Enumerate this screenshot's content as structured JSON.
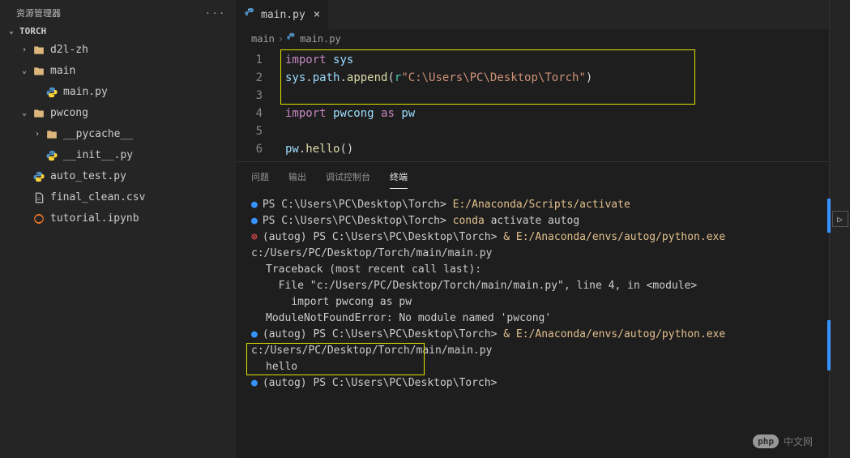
{
  "sidebar": {
    "title": "资源管理器",
    "project": "TORCH",
    "items": [
      {
        "name": "d2l-zh",
        "type": "folder",
        "indent": 1,
        "expanded": false
      },
      {
        "name": "main",
        "type": "folder",
        "indent": 1,
        "expanded": true
      },
      {
        "name": "main.py",
        "type": "py",
        "indent": 2
      },
      {
        "name": "pwcong",
        "type": "folder",
        "indent": 1,
        "expanded": true
      },
      {
        "name": "__pycache__",
        "type": "folder",
        "indent": 2,
        "expanded": false
      },
      {
        "name": "__init__.py",
        "type": "py",
        "indent": 2
      },
      {
        "name": "auto_test.py",
        "type": "py",
        "indent": 1
      },
      {
        "name": "final_clean.csv",
        "type": "csv",
        "indent": 1
      },
      {
        "name": "tutorial.ipynb",
        "type": "ipynb",
        "indent": 1
      }
    ]
  },
  "tab": {
    "filename": "main.py"
  },
  "breadcrumb": {
    "seg1": "main",
    "seg2": "main.py"
  },
  "code": {
    "lines": [
      {
        "n": "1",
        "tokens": [
          [
            "kw",
            "import"
          ],
          [
            "pln",
            " "
          ],
          [
            "var",
            "sys"
          ]
        ]
      },
      {
        "n": "2",
        "tokens": [
          [
            "var",
            "sys"
          ],
          [
            "pln",
            "."
          ],
          [
            "var",
            "path"
          ],
          [
            "pln",
            "."
          ],
          [
            "fn",
            "append"
          ],
          [
            "pln",
            "("
          ],
          [
            "obj",
            "r"
          ],
          [
            "str",
            "\"C:\\Users\\PC\\Desktop\\Torch\""
          ],
          [
            "pln",
            ")"
          ]
        ]
      },
      {
        "n": "3",
        "tokens": []
      },
      {
        "n": "4",
        "tokens": [
          [
            "kw",
            "import"
          ],
          [
            "pln",
            " "
          ],
          [
            "var",
            "pwcong"
          ],
          [
            "pln",
            " "
          ],
          [
            "kw",
            "as"
          ],
          [
            "pln",
            " "
          ],
          [
            "var",
            "pw"
          ]
        ]
      },
      {
        "n": "5",
        "tokens": []
      },
      {
        "n": "6",
        "tokens": [
          [
            "var",
            "pw"
          ],
          [
            "pln",
            "."
          ],
          [
            "fn",
            "hello"
          ],
          [
            "pln",
            "()"
          ]
        ]
      }
    ]
  },
  "panel": {
    "tabs": {
      "problems": "问题",
      "output": "输出",
      "debug": "调试控制台",
      "terminal": "终端"
    }
  },
  "terminal": {
    "lines": [
      {
        "bullet": "blue",
        "parts": [
          [
            "w",
            "PS C:\\Users\\PC\\Desktop\\Torch> "
          ],
          [
            "g",
            "E:/Anaconda/Scripts/activate"
          ]
        ]
      },
      {
        "bullet": "blue",
        "parts": [
          [
            "w",
            "PS C:\\Users\\PC\\Desktop\\Torch> "
          ],
          [
            "g",
            "conda "
          ],
          [
            "w",
            "activate autog"
          ]
        ]
      },
      {
        "bullet": "red",
        "parts": [
          [
            "w",
            "(autog) PS C:\\Users\\PC\\Desktop\\Torch> "
          ],
          [
            "g",
            "& "
          ],
          [
            "g",
            "E:/Anaconda/envs/autog/python.exe "
          ],
          [
            "w",
            "c:/Users/PC/Desktop/Torch/main/main.py"
          ]
        ]
      },
      {
        "bullet": "",
        "parts": [
          [
            "w",
            "Traceback (most recent call last):"
          ]
        ]
      },
      {
        "bullet": "",
        "parts": [
          [
            "w",
            "  File \"c:/Users/PC/Desktop/Torch/main/main.py\", line 4, in <module>"
          ]
        ]
      },
      {
        "bullet": "",
        "parts": [
          [
            "w",
            "    import pwcong as pw"
          ]
        ]
      },
      {
        "bullet": "",
        "parts": [
          [
            "w",
            "ModuleNotFoundError: No module named 'pwcong'"
          ]
        ]
      },
      {
        "bullet": "blue",
        "parts": [
          [
            "w",
            "(autog) PS C:\\Users\\PC\\Desktop\\Torch> "
          ],
          [
            "g",
            "& "
          ],
          [
            "g",
            "E:/Anaconda/envs/autog/python.exe "
          ],
          [
            "w",
            "c:/Users/PC/Desktop/Torch/main/main.py"
          ]
        ]
      },
      {
        "bullet": "",
        "parts": [
          [
            "w",
            "hello"
          ]
        ]
      },
      {
        "bullet": "blue",
        "parts": [
          [
            "w",
            "(autog) PS C:\\Users\\PC\\Desktop\\Torch> "
          ]
        ]
      }
    ]
  },
  "watermark": {
    "logo": "php",
    "text": "中文网"
  }
}
